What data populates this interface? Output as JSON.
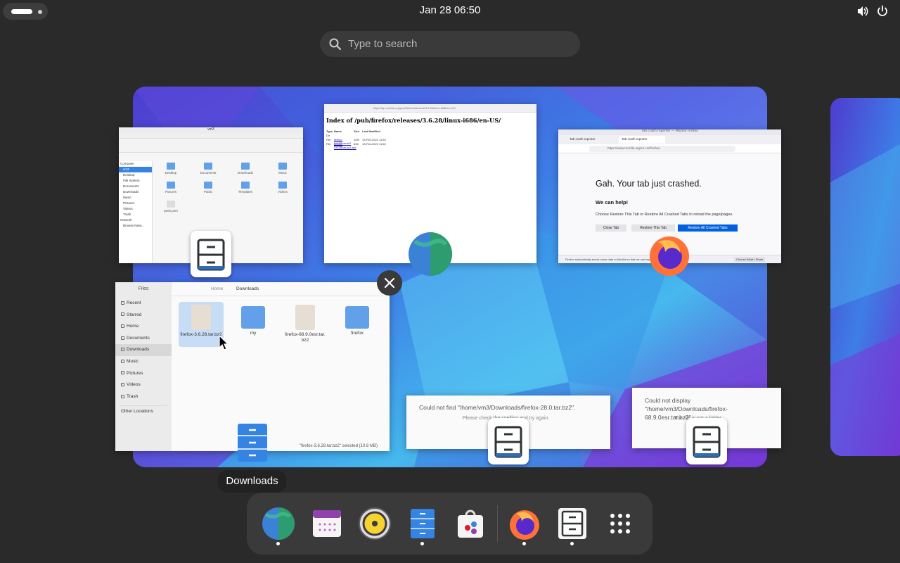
{
  "topbar": {
    "clock": "Jan 28  06:50"
  },
  "search": {
    "placeholder": "Type to search"
  },
  "windows": {
    "file_manager_old": {
      "title": "vm3",
      "sidebar": [
        "Computer",
        "vm3",
        "Desktop",
        "File System",
        "Documents",
        "Downloads",
        "Music",
        "Pictures",
        "Videos",
        "Trash",
        "Network",
        "Browse Netw..."
      ],
      "folders": [
        "Desktop",
        "Documents",
        "Downloads",
        "Music",
        "Pictures",
        "Public",
        "Templates",
        "Videos",
        "peek.pem"
      ]
    },
    "browser_index": {
      "url": "https://ftp.mozilla.org/pub/firefox/releases/3.6.28/linux-i686/en-US/",
      "heading": "Index of /pub/firefox/releases/3.6.28/linux-i686/en-US/",
      "columns": [
        "Type",
        "Name",
        "Size",
        "Last Modified"
      ],
      "rows": [
        [
          "Dir",
          "",
          "",
          ""
        ],
        [
          "File",
          "firefox-3.6.28.tar.bz2",
          "10M",
          "13-Feb-2022 11:54"
        ],
        [
          "File",
          "firefox-3.6.28.tar.bz2.asc",
          "836",
          "13-Feb-2022 11:54"
        ]
      ]
    },
    "crash_report": {
      "title": "Tab crash reporter — Mozilla Firefox",
      "tab1": "Tab crash reporter",
      "tab2": "Tab crash reporter",
      "url": "https://www.mozilla.org/en-US/firefox/",
      "heading": "Gah. Your tab just crashed.",
      "subheading": "We can help!",
      "body": "Choose Restore This Tab or Restore All Crashed Tabs to reload the page/pages.",
      "btn_close": "Close Tab",
      "btn_restore": "Restore This Tab",
      "btn_restore_all": "Restore All Crashed Tabs",
      "footer": "Firefox automatically sends some data to Mozilla so that we can improve your experience.",
      "footer_btn": "Choose What I Share"
    },
    "files": {
      "title": "Files",
      "path_home": "Home",
      "path_current": "Downloads",
      "sidebar": [
        "Recent",
        "Starred",
        "Home",
        "Documents",
        "Downloads",
        "Music",
        "Pictures",
        "Videos",
        "Trash"
      ],
      "other_locations": "Other Locations",
      "items": [
        "firefox-3.6.28.tar.bz2",
        "my",
        "firefox-68.9.0esr.tar.bz2",
        "firefox"
      ],
      "status": "\"firefox-3.6.28.tar.bz2\" selected (10.8 MB)"
    },
    "dialog1": {
      "message": "Could not find \"/home/vm3/Downloads/firefox-28.0.tar.bz2\".",
      "detail": "Please check the spelling and try again."
    },
    "dialog2": {
      "message": "Could not display \"/home/vm3/Downloads/firefox-68.9.0esr.tar.bz2\".",
      "detail": "The file is not a folder."
    }
  },
  "tooltip": "Downloads",
  "dock": [
    {
      "name": "Web",
      "running": true
    },
    {
      "name": "Calendar",
      "running": false
    },
    {
      "name": "Rhythmbox",
      "running": false
    },
    {
      "name": "Files",
      "running": true
    },
    {
      "name": "Software",
      "running": false
    },
    {
      "name": "Firefox",
      "running": true
    },
    {
      "name": "File Manager",
      "running": true
    },
    {
      "name": "Show Apps",
      "running": false
    }
  ],
  "colors": {
    "accent": "#3584e4",
    "folder": "#62a0ea",
    "panel": "#2a2a2a"
  }
}
